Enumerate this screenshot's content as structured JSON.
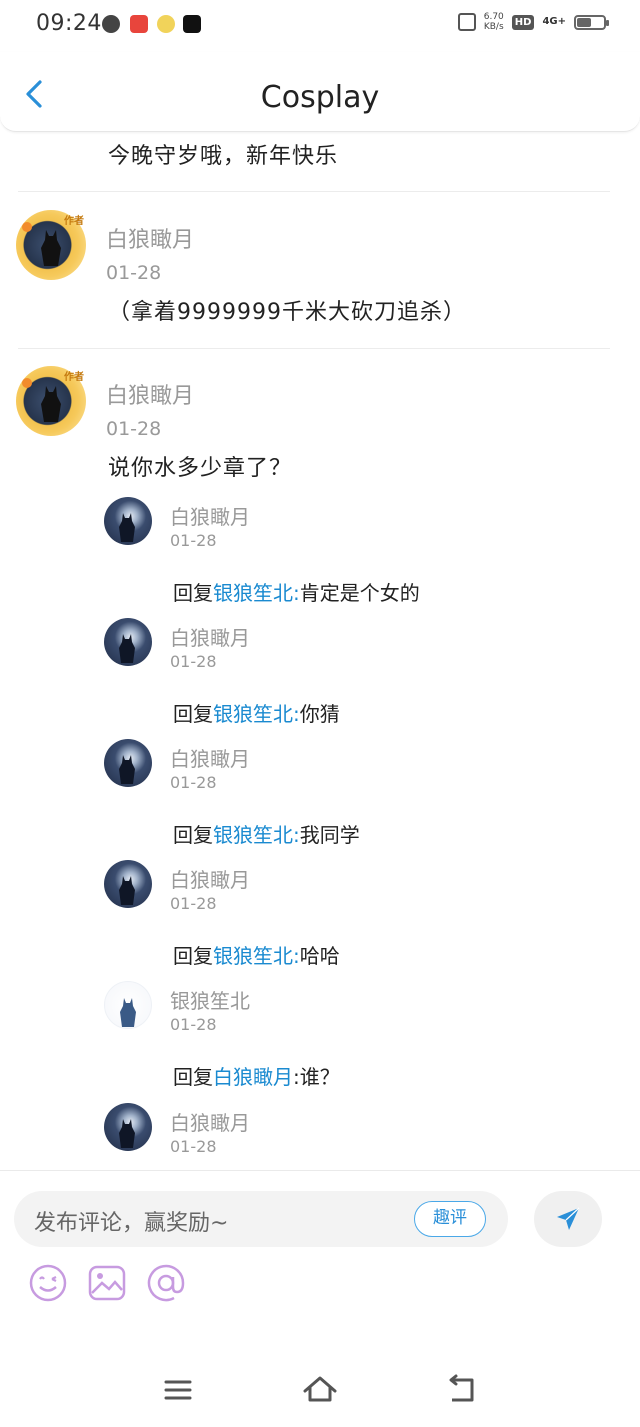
{
  "status_bar": {
    "time": "09:24",
    "net_speed_value": "6.70",
    "net_speed_unit": "KB/s",
    "hd_label": "HD",
    "network": "4G+",
    "battery_level": 0.5
  },
  "header": {
    "title": "Cosplay",
    "back_icon": "chevron-left-icon"
  },
  "first_comment_tail": {
    "text": "今晚守岁哦，新年快乐"
  },
  "comments": [
    {
      "name": "白狼瞰月",
      "date": "01-28",
      "badge": "作者",
      "text": "（拿着9999999千米大砍刀追杀）"
    },
    {
      "name": "白狼瞰月",
      "date": "01-28",
      "badge": "作者",
      "text": "说你水多少章了？"
    }
  ],
  "replies": [
    {
      "name": "白狼瞰月",
      "date": "01-28",
      "prefix": "回复",
      "mention": "银狼笙北",
      "sep": ":",
      "text": "肯定是个女的"
    },
    {
      "name": "白狼瞰月",
      "date": "01-28",
      "prefix": "回复",
      "mention": "银狼笙北",
      "sep": ":",
      "text": "你猜"
    },
    {
      "name": "白狼瞰月",
      "date": "01-28",
      "prefix": "回复",
      "mention": "银狼笙北",
      "sep": ":",
      "text": "我同学"
    },
    {
      "name": "白狼瞰月",
      "date": "01-28",
      "prefix": "回复",
      "mention": "银狼笙北",
      "sep": ":",
      "text": "哈哈"
    },
    {
      "name": "银狼笙北",
      "date": "01-28",
      "prefix": "回复",
      "mention": "白狼瞰月",
      "sep": ":",
      "text": "谁？"
    },
    {
      "name": "白狼瞰月",
      "date": "01-28"
    }
  ],
  "comment_bar": {
    "placeholder": "发布评论，赢奖励~",
    "quping_label": "趣评",
    "send_icon": "send-icon",
    "tools": [
      "emoji-icon",
      "image-icon",
      "at-icon"
    ]
  },
  "nav_bar": {
    "icons": [
      "menu-icon",
      "home-icon",
      "back-icon"
    ]
  },
  "colors": {
    "accent": "#2a8fd8",
    "mention": "#1a8ad0",
    "tool_icon": "#c79be0"
  }
}
